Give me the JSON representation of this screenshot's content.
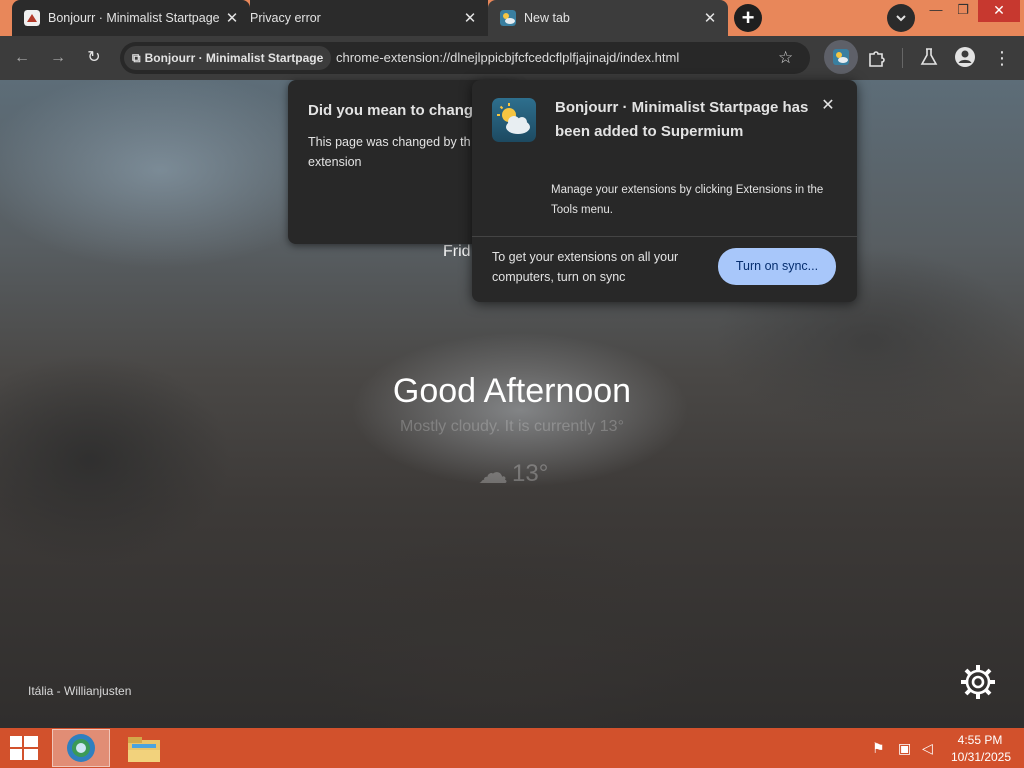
{
  "tabs": [
    {
      "title": "Bonjourr · Minimalist Startpage",
      "close": "✕",
      "icon": "bonjourr-favicon"
    },
    {
      "title": "Privacy error",
      "close": "✕",
      "icon": "none"
    },
    {
      "title": "New tab",
      "close": "✕",
      "icon": "bonjourr-weather-favicon"
    }
  ],
  "tabstrip": {
    "new_tab": "+"
  },
  "window_controls": {
    "minimize": "—",
    "maximize": "❐",
    "close": "✕"
  },
  "toolbar": {
    "back": "←",
    "forward": "→",
    "reload": "↻",
    "site_chip_label": "Bonjourr · Minimalist Startpage",
    "url": "chrome-extension://dlnejlppicbjfcfcedcflplfjajinajd/index.html",
    "star": "☆",
    "extensions": "puzzle",
    "labs": "flask",
    "profile": "person",
    "menu": "⋮"
  },
  "page": {
    "date_partial": "Frid",
    "greeting": "Good Afternoon",
    "weather_description": "Mostly cloudy. It is currently 13°",
    "temperature": "13°",
    "photo_credit": "Itália - Willianjusten"
  },
  "bubble_change": {
    "title": "Did you mean to chang",
    "body_line1": "This page was changed by th",
    "body_line2": "extension"
  },
  "bubble_added": {
    "title": "Bonjourr · Minimalist Startpage has been added to Supermium",
    "close": "✕",
    "manage_text": "Manage your extensions by clicking Extensions in the Tools menu.",
    "sync_text": "To get your extensions on all your computers, turn on sync",
    "sync_button": "Turn on sync..."
  },
  "taskbar": {
    "time": "4:55 PM",
    "date": "10/31/2025"
  },
  "colors": {
    "tabstrip_bg": "#e8875a",
    "toolbar_bg": "#3c3c3c",
    "bubble_bg": "#282828",
    "sync_button_bg": "#a8c7fa",
    "taskbar_bg": "#d2512c"
  }
}
